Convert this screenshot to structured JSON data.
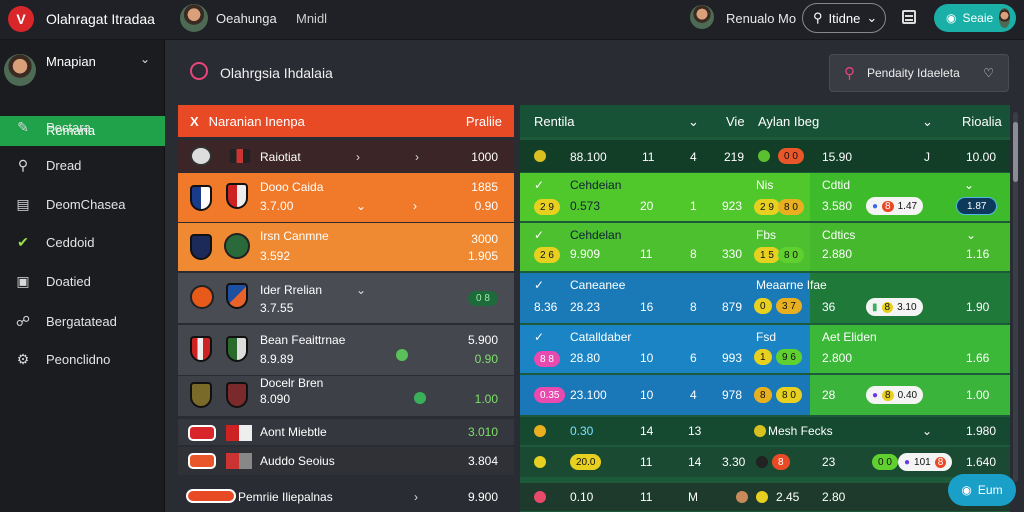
{
  "app": {
    "logo": "V",
    "title": "Olahragat Itradaa"
  },
  "topbar": {
    "user_name": "Oeahunga",
    "nav_item": "Mnidl",
    "user2_name": "Renualo Mo",
    "search_label": "Itidne",
    "save_label": "Seaie"
  },
  "sidebar": {
    "profile_name": "Mnapian",
    "active_item": "Remaria",
    "items": [
      {
        "label": "Pectara",
        "icon": "edit-icon"
      },
      {
        "label": "Dread",
        "icon": "search-icon"
      },
      {
        "label": "DeomChasea",
        "icon": "document-icon"
      },
      {
        "label": "Ceddoid",
        "icon": "check-icon"
      },
      {
        "label": "Doatied",
        "icon": "tablet-icon"
      },
      {
        "label": "Bergatatead",
        "icon": "link-icon"
      },
      {
        "label": "Peonclidno",
        "icon": "gear-icon"
      }
    ]
  },
  "page": {
    "title": "Olahrgsia Ihdalaia",
    "results_button": "Pendaity Idaeleta"
  },
  "left_panel": {
    "header_left": "Naranian Inenpa",
    "header_right": "Praliie",
    "rows": [
      {
        "name": "Raiotiat",
        "value": "1000"
      },
      {
        "name": "Dooo Caida",
        "sub": "3.7.00",
        "value_top": "1885",
        "value": "0.90"
      },
      {
        "name": "Irsn Canmne",
        "sub": "3.592",
        "value_top": "3000",
        "value": "1.905"
      },
      {
        "name": "Ider Rrelian",
        "sub": "3.7.55",
        "pill": "0 8"
      },
      {
        "name": "Bean Feaittrnae",
        "sub": "8.9.89",
        "value_top": "5.900",
        "value": "0.90"
      },
      {
        "name": "Docelr Bren",
        "sub": "8.090",
        "value": "1.00"
      },
      {
        "name": "Aont Miebtle",
        "value": "3.010"
      },
      {
        "name": "Auddo Seoius",
        "value": "3.804"
      },
      {
        "name": "Pemriie Iliepalnas",
        "value": "9.900"
      }
    ]
  },
  "right_panel": {
    "col1": "Rentila",
    "col2": "Vie",
    "col3": "Aylan Ibeg",
    "col4": "Rioalia",
    "rows": [
      {
        "a": "88.100",
        "b": "11",
        "c": "4",
        "d": "219",
        "e": "15.90",
        "f": "J",
        "g": "10.00"
      },
      {
        "title": "Cehdeian",
        "a": "0.573",
        "b": "20",
        "c": "1",
        "d": "923",
        "m": "Nis",
        "mt": "Cdtid",
        "e": "3.580",
        "g": "1.87",
        "h": "1.47"
      },
      {
        "title": "Cehdelan",
        "a": "9.909",
        "b": "11",
        "c": "8",
        "d": "330",
        "m": "Fbs",
        "mt": "Cdtics",
        "e": "2.880",
        "g": "1.16"
      },
      {
        "title": "Caneanee",
        "a": "8.36",
        "a2": "28.23",
        "b": "16",
        "c": "8",
        "d": "879",
        "m": "Meaarne Ifae",
        "e": "36",
        "g": "1.90",
        "h": "3.10"
      },
      {
        "title": "Catalldaber",
        "a": "28.80",
        "b": "10",
        "c": "6",
        "d": "993",
        "m": "Fsd",
        "mt": "Aet Eliden",
        "e": "2.800",
        "g": "1.66"
      },
      {
        "a": "0.35",
        "a2": "23.100",
        "b": "10",
        "c": "4",
        "d": "978",
        "e": "28",
        "g": "1.00",
        "h": "0.40"
      },
      {
        "a": "0.30",
        "b": "14",
        "c": "13",
        "d": "Mesh Fecks",
        "g": "1.980"
      },
      {
        "a": "20.0",
        "b": "11",
        "c": "14",
        "d": "3.30",
        "e": "23",
        "g": "1.640",
        "h": "101"
      },
      {
        "a": "0.10",
        "b": "11",
        "c": "M",
        "d": "2.45",
        "e": "2.80"
      }
    ]
  },
  "fab_label": "Eum"
}
